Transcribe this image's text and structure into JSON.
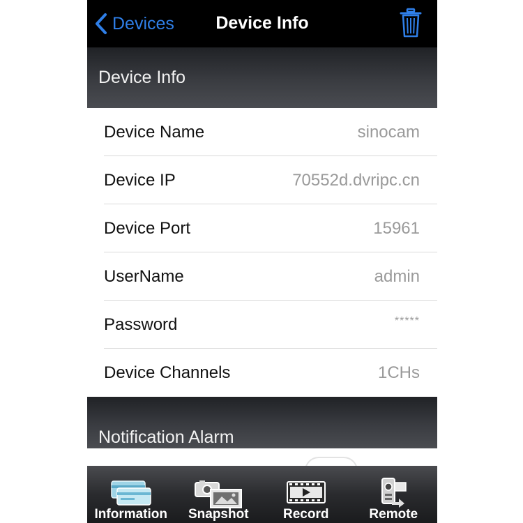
{
  "nav": {
    "back_label": "Devices",
    "title": "Device Info"
  },
  "sections": {
    "info_header": "Device Info",
    "alarm_header": "Notification Alarm"
  },
  "rows": [
    {
      "label": "Device Name",
      "value": "sinocam"
    },
    {
      "label": "Device IP",
      "value": "70552d.dvripc.cn"
    },
    {
      "label": "Device Port",
      "value": "15961"
    },
    {
      "label": "UserName",
      "value": "admin"
    },
    {
      "label": "Password",
      "value": "*****"
    },
    {
      "label": "Device Channels",
      "value": "1CHs"
    }
  ],
  "tabs": [
    {
      "label": "Information",
      "icon": "information-icon"
    },
    {
      "label": "Snapshot",
      "icon": "snapshot-icon"
    },
    {
      "label": "Record",
      "icon": "record-icon"
    },
    {
      "label": "Remote",
      "icon": "remote-icon"
    }
  ],
  "colors": {
    "accent": "#2f7fe8",
    "value_text": "#9a9a9a"
  }
}
